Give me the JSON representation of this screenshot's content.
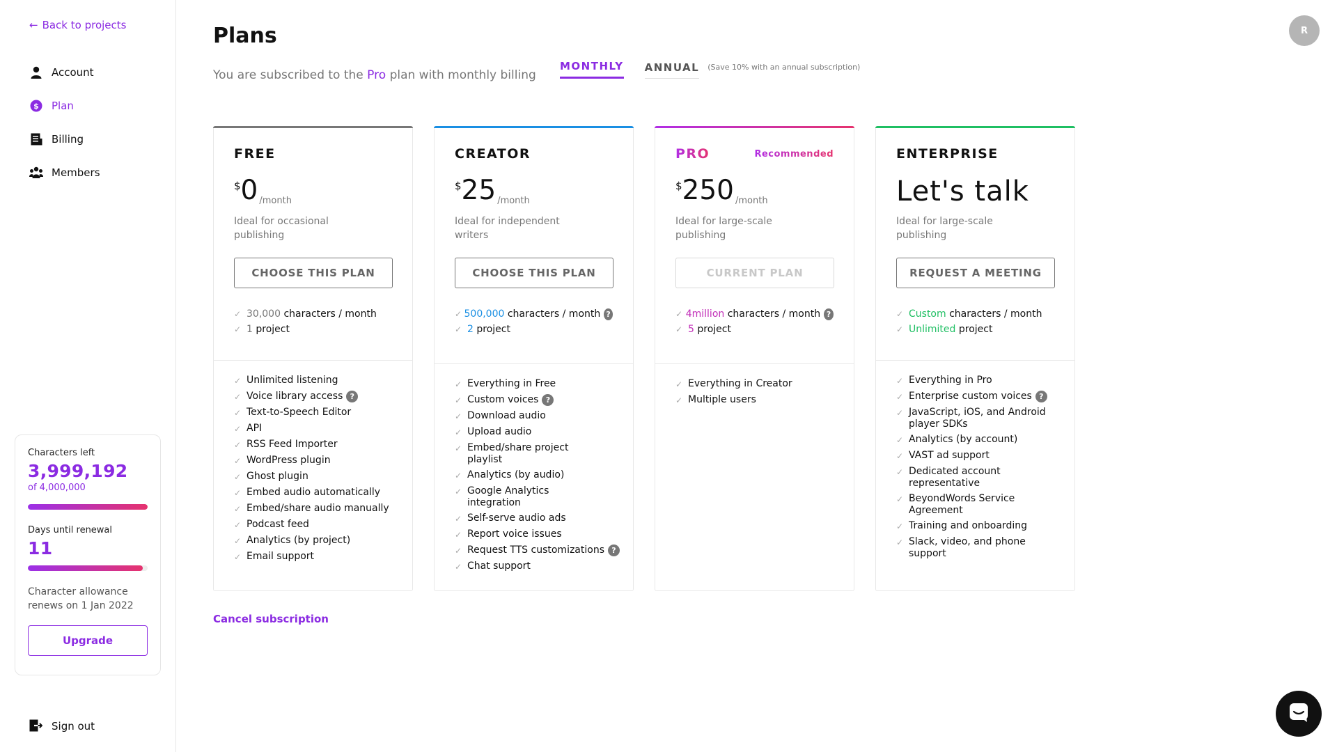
{
  "sidebar": {
    "back_label": "Back to projects",
    "nav": [
      {
        "label": "Account",
        "icon": "user-icon"
      },
      {
        "label": "Plan",
        "icon": "dollar-icon"
      },
      {
        "label": "Billing",
        "icon": "receipt-icon"
      },
      {
        "label": "Members",
        "icon": "users-icon"
      }
    ],
    "usage": {
      "characters_label": "Characters left",
      "characters_value": "3,999,192",
      "characters_total": "of 4,000,000",
      "characters_fraction": 0.9998,
      "renewal_label": "Days until renewal",
      "renewal_value": "11",
      "renewal_fraction": 0.96,
      "note": "Character allowance renews on 1 Jan 2022",
      "upgrade_label": "Upgrade"
    },
    "signout_label": "Sign out"
  },
  "header": {
    "title": "Plans",
    "sub_prefix": "You are subscribed to the",
    "sub_plan": "Pro",
    "sub_suffix": "plan with monthly billing",
    "tabs": [
      {
        "label": "MONTHLY",
        "active": true
      },
      {
        "label": "ANNUAL",
        "active": false
      }
    ],
    "annual_note": "(Save 10% with an annual subscription)",
    "avatar_initial": "R"
  },
  "colors": {
    "accent": "#8b2be2",
    "free": "#777777",
    "creator": "#1a8fe3",
    "pro_start": "#b12ee6",
    "pro_end": "#e6336e",
    "enterprise": "#1fbf63"
  },
  "plans": [
    {
      "name": "FREE",
      "currency": "$",
      "amount": "0",
      "per": "/month",
      "tagline": "Ideal for occasional publishing",
      "button": "CHOOSE THIS PLAN",
      "quota": [
        {
          "highlight": "30,000",
          "text": "characters / month"
        },
        {
          "highlight": "1",
          "text": "project"
        }
      ],
      "features": [
        "Unlimited listening",
        "Voice library access",
        "Text-to-Speech Editor",
        "API",
        "RSS Feed Importer",
        "WordPress plugin",
        "Ghost plugin",
        "Embed audio automatically",
        "Embed/share audio manually",
        "Podcast feed",
        "Analytics (by project)",
        "Email support"
      ]
    },
    {
      "name": "CREATOR",
      "currency": "$",
      "amount": "25",
      "per": "/month",
      "tagline": "Ideal for independent writers",
      "button": "CHOOSE THIS PLAN",
      "quota": [
        {
          "highlight": "500,000",
          "text": "characters / month"
        },
        {
          "highlight": "2",
          "text": "project"
        }
      ],
      "features": [
        "Everything in Free",
        "Custom voices",
        "Download audio",
        "Upload audio",
        "Embed/share project playlist",
        "Analytics (by audio)",
        "Google Analytics integration",
        "Self-serve audio ads",
        "Report voice issues",
        "Request TTS customizations",
        "Chat support"
      ]
    },
    {
      "name": "PRO",
      "recommended": "Recommended",
      "currency": "$",
      "amount": "250",
      "per": "/month",
      "tagline": "Ideal for large-scale publishing",
      "button": "CURRENT PLAN",
      "quota": [
        {
          "highlight": "4million",
          "text": "characters / month"
        },
        {
          "highlight": "5",
          "text": "project"
        }
      ],
      "features": [
        "Everything in Creator",
        "Multiple users"
      ]
    },
    {
      "name": "ENTERPRISE",
      "price_text": "Let's talk",
      "tagline": "Ideal for large-scale publishing",
      "button": "REQUEST A MEETING",
      "quota": [
        {
          "highlight": "Custom",
          "text": "characters / month"
        },
        {
          "highlight": "Unlimited",
          "text": "project"
        }
      ],
      "features": [
        "Everything in Pro",
        "Enterprise custom voices",
        "JavaScript, iOS, and Android player SDKs",
        "Analytics (by account)",
        "VAST ad support",
        "Dedicated account representative",
        "BeyondWords Service Agreement",
        "Training and onboarding",
        "Slack, video, and phone support"
      ]
    }
  ],
  "cancel_label": "Cancel subscription"
}
